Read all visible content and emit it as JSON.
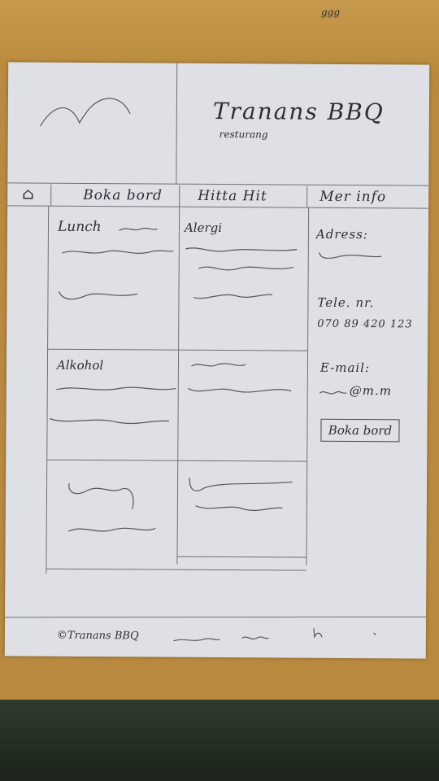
{
  "desk": {
    "mark_text": "ggg"
  },
  "header": {
    "title": "Tranans BBQ",
    "subtitle": "resturang"
  },
  "nav": {
    "home_icon": "home-icon",
    "items": [
      {
        "label": "Boka bord"
      },
      {
        "label": "Hitta Hit"
      },
      {
        "label": "Mer info"
      }
    ]
  },
  "grid": {
    "lunch_title": "Lunch",
    "allergy_title": "Alergi",
    "alcohol_title": "Alkohol"
  },
  "sidebar": {
    "address_label": "Adress:",
    "phone_label": "Tele. nr.",
    "phone_value": "070 89 420 123",
    "email_label": "E-mail:",
    "email_value": "@m.m",
    "book_button": "Boka bord"
  },
  "footer": {
    "copyright": "©Tranans BBQ"
  }
}
